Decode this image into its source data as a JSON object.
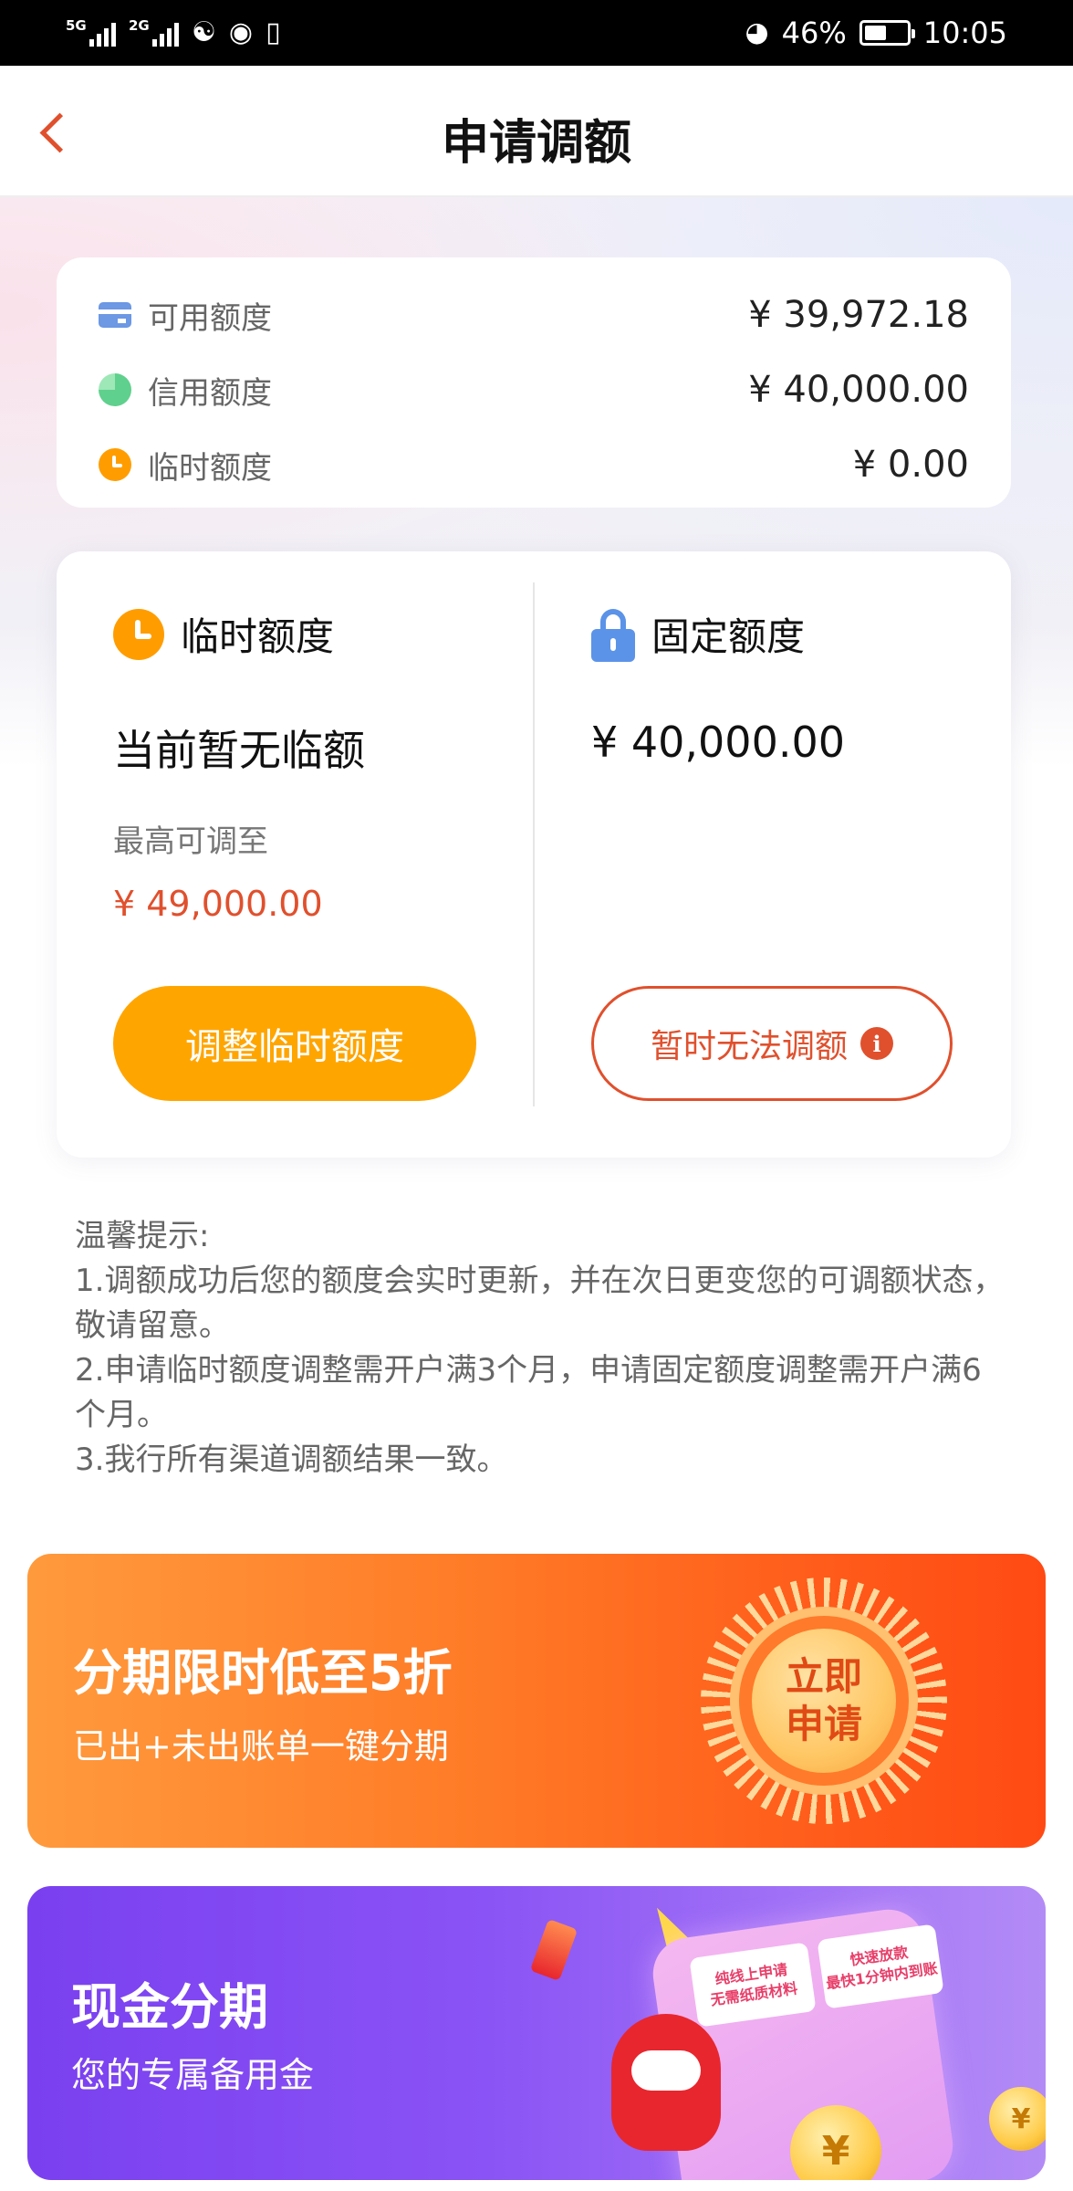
{
  "status_bar": {
    "network1": "5G",
    "network2": "2G",
    "battery": "46%",
    "time": "10:05"
  },
  "header": {
    "title": "申请调额"
  },
  "summary": {
    "rows": [
      {
        "label": "可用额度",
        "value": "¥ 39,972.18",
        "icon": "card-icon"
      },
      {
        "label": "信用额度",
        "value": "¥ 40,000.00",
        "icon": "pie-icon"
      },
      {
        "label": "临时额度",
        "value": "¥ 0.00",
        "icon": "clock-icon"
      }
    ]
  },
  "temp_quota": {
    "label": "临时额度",
    "main": "当前暂无临额",
    "sub": "最高可调至",
    "max": "¥ 49,000.00",
    "button": "调整临时额度"
  },
  "fixed_quota": {
    "label": "固定额度",
    "main": "¥ 40,000.00",
    "button": "暂时无法调额",
    "info_glyph": "i"
  },
  "tips": {
    "title": "温馨提示:",
    "line1": "1.调额成功后您的额度会实时更新，并在次日更变您的可调额状态，敬请留意。",
    "line2": "2.申请临时额度调整需开户满3个月，申请固定额度调整需开户满6个月。",
    "line3": "3.我行所有渠道调额结果一致。"
  },
  "banner_installment": {
    "title": "分期限时低至5折",
    "subtitle": "已出+未出账单一键分期",
    "coin_line1": "立即",
    "coin_line2": "申请"
  },
  "banner_cash": {
    "title": "现金分期",
    "subtitle": "您的专属备用金",
    "tag1_line1": "纯线上申请",
    "tag1_line2": "无需纸质材料",
    "tag2_line1": "快速放款",
    "tag2_line2": "最快1分钟内到账"
  },
  "colors": {
    "accent_red": "#e0502d",
    "accent_orange": "#ffa500",
    "lock_blue": "#5b93e8"
  }
}
